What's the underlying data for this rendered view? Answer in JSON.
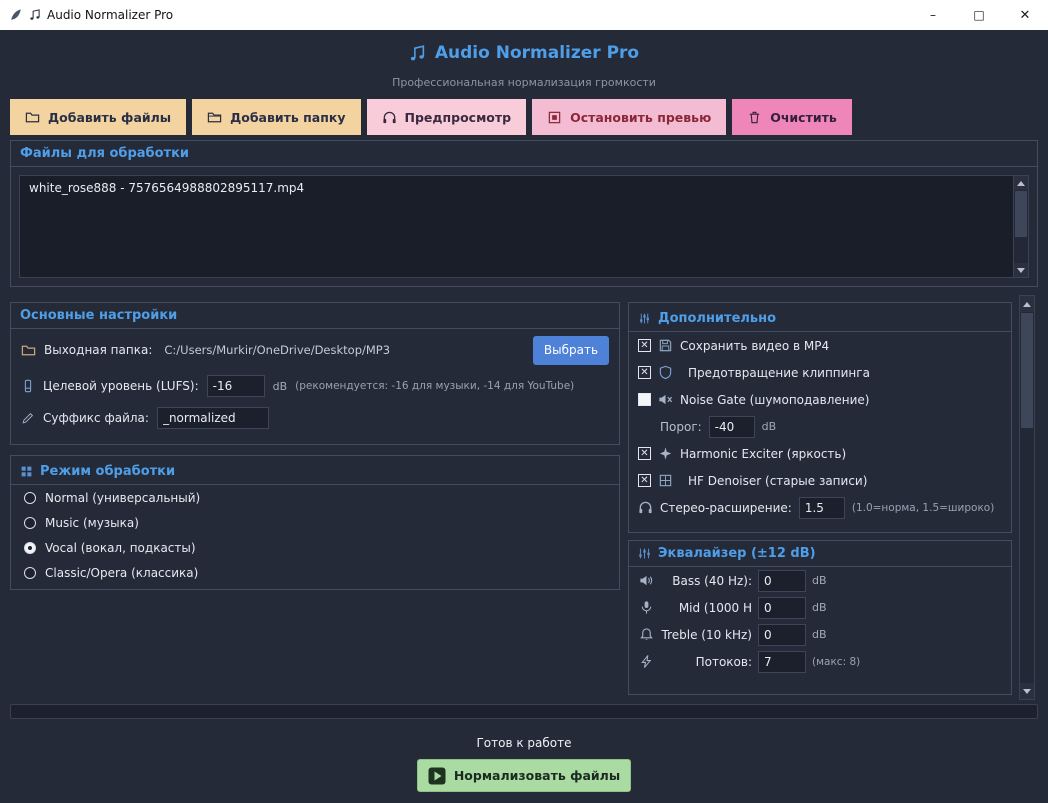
{
  "colors": {
    "background": "#252a38",
    "accent_blue": "#4f9ee8",
    "button_tan": "#f3d3a0",
    "button_pink_light": "#f8ccd9",
    "button_pink": "#f4bcd2",
    "button_magenta": "#ee86b9",
    "choose_blue": "#4e81d8",
    "normalize_green": "#aadba2"
  },
  "window": {
    "title": "Audio Normalizer Pro",
    "minimize": "–",
    "maximize": "□",
    "close": "✕"
  },
  "header": {
    "title": "Audio Normalizer Pro",
    "subtitle": "Профессиональная нормализация громкости"
  },
  "toolbar": {
    "add_files": "Добавить файлы",
    "add_folder": "Добавить папку",
    "preview": "Предпросмотр",
    "stop_preview": "Остановить превью",
    "clear": "Очистить"
  },
  "files": {
    "title": "Файлы для обработки",
    "items": [
      "white_rose888 - 7576564988802895117.mp4"
    ]
  },
  "settings": {
    "title": "Основные настройки",
    "output_label": "Выходная папка:",
    "output_value": "C:/Users/Murkir/OneDrive/Desktop/MP3",
    "choose": "Выбрать",
    "target_label": "Целевой уровень (LUFS):",
    "target_value": "-16",
    "target_unit": "dB",
    "target_hint": "(рекомендуется: -16 для музыки, -14 для YouTube)",
    "suffix_label": "Суффикс файла:",
    "suffix_value": "_normalized"
  },
  "mode": {
    "title": "Режим обработки",
    "options": [
      {
        "label": "Normal (универсальный)",
        "selected": false
      },
      {
        "label": "Music (музыка)",
        "selected": false
      },
      {
        "label": "Vocal (вокал, подкасты)",
        "selected": true
      },
      {
        "label": "Classic/Opera (классика)",
        "selected": false
      }
    ]
  },
  "advanced": {
    "title": "Дополнительно",
    "save_mp4_label": "Сохранить видео в MP4",
    "save_mp4_checked": true,
    "clipping_label": "Предотвращение клиппинга",
    "clipping_checked": true,
    "noise_gate_label": "Noise Gate (шумоподавление)",
    "noise_gate_checked": false,
    "threshold_label": "Порог:",
    "threshold_value": "-40",
    "threshold_unit": "dB",
    "exciter_label": "Harmonic Exciter (яркость)",
    "exciter_checked": true,
    "denoiser_label": "HF Denoiser (старые записи)",
    "denoiser_checked": true,
    "stereo_label": "Стерео-расширение:",
    "stereo_value": "1.5",
    "stereo_hint": "(1.0=норма, 1.5=широко)"
  },
  "equalizer": {
    "title": "Эквалайзер (±12 dB)",
    "bands": [
      {
        "label": "Bass (40 Hz):",
        "value": "0",
        "unit": "dB"
      },
      {
        "label": "Mid (1000 H",
        "value": "0",
        "unit": "dB"
      },
      {
        "label": "Treble (10 kHz)",
        "value": "0",
        "unit": "dB"
      }
    ],
    "threads_label": "Потоков:",
    "threads_value": "7",
    "threads_hint": "(макс: 8)"
  },
  "footer": {
    "status": "Готов к работе",
    "normalize": "Нормализовать файлы"
  }
}
